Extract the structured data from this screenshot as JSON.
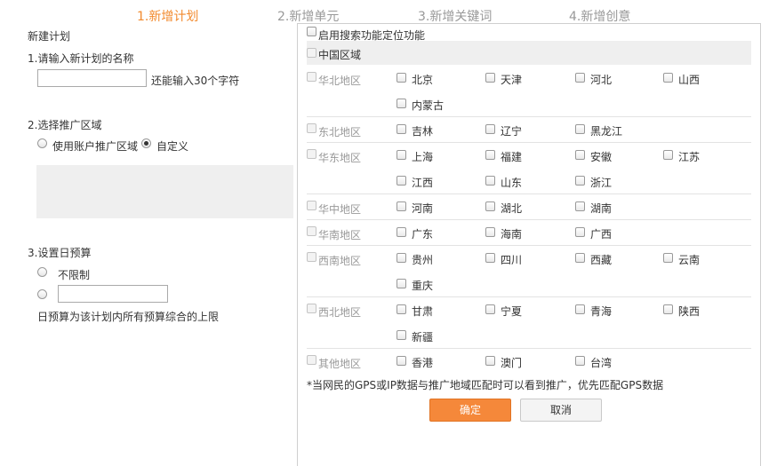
{
  "steps": [
    "1.新增计划",
    "2.新增单元",
    "3.新增关键词",
    "4.新增创意"
  ],
  "form": {
    "section_title": "新建计划",
    "q1_label": "1.请输入新计划的名称",
    "name_value": "",
    "name_hint": "还能输入30个字符",
    "q2_label": "2.选择推广区域",
    "region_option_account": "使用账户推广区域",
    "region_option_custom": "自定义",
    "region_selected": "自定义",
    "q3_label": "3.设置日预算",
    "budget_unlimited": "不限制",
    "budget_value": "",
    "budget_note": "日预算为该计划内所有预算综合的上限"
  },
  "panel": {
    "search_location_label": "启用搜索功能定位功能",
    "china_label": "中国区域",
    "regions": [
      {
        "name": "华北地区",
        "rows": [
          [
            "北京",
            "天津",
            "河北",
            "山西"
          ],
          [
            "内蒙古"
          ]
        ]
      },
      {
        "name": "东北地区",
        "rows": [
          [
            "吉林",
            "辽宁",
            "黑龙江"
          ]
        ]
      },
      {
        "name": "华东地区",
        "rows": [
          [
            "上海",
            "福建",
            "安徽",
            "江苏"
          ],
          [
            "江西",
            "山东",
            "浙江"
          ]
        ]
      },
      {
        "name": "华中地区",
        "rows": [
          [
            "河南",
            "湖北",
            "湖南"
          ]
        ]
      },
      {
        "name": "华南地区",
        "rows": [
          [
            "广东",
            "海南",
            "广西"
          ]
        ]
      },
      {
        "name": "西南地区",
        "rows": [
          [
            "贵州",
            "四川",
            "西藏",
            "云南"
          ],
          [
            "重庆"
          ]
        ]
      },
      {
        "name": "西北地区",
        "rows": [
          [
            "甘肃",
            "宁夏",
            "青海",
            "陕西"
          ],
          [
            "新疆"
          ]
        ]
      },
      {
        "name": "其他地区",
        "rows": [
          [
            "香港",
            "澳门",
            "台湾"
          ]
        ]
      }
    ],
    "note": "*当网民的GPS或IP数据与推广地域匹配时可以看到推广，优先匹配GPS数据",
    "ok_label": "确定",
    "cancel_label": "取消"
  },
  "colors": {
    "accent": "#f28a2e",
    "button": "#f5883a"
  }
}
